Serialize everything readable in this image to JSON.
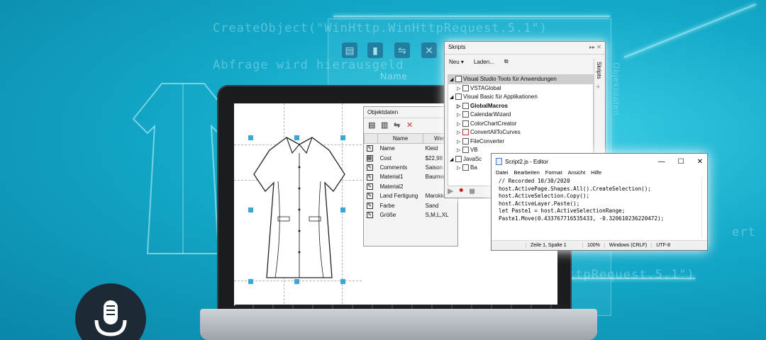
{
  "background": {
    "code_lines": [
      "CreateObject(\"WinHttp.WinHttpRequest.5.1\")",
      "Abfrage wird hierausgeld",
      "ttpRequest.5.1\")",
      "ert"
    ],
    "panel_label": "Name",
    "side_label": "Objektdaten"
  },
  "objektdaten": {
    "title": "Objektdaten",
    "headers": [
      "Name",
      "Wert"
    ],
    "rows": [
      {
        "name": "Name",
        "value": "Kleid"
      },
      {
        "name": "Cost",
        "value": "$22,98"
      },
      {
        "name": "Comments",
        "value": "Saison W5"
      },
      {
        "name": "Material1",
        "value": "Baumwoll"
      },
      {
        "name": "Material2",
        "value": ""
      },
      {
        "name": "Land Fertigung",
        "value": "Marokko"
      },
      {
        "name": "Farbe",
        "value": "Sand"
      },
      {
        "name": "Größe",
        "value": "S,M,L,XL"
      }
    ]
  },
  "skripts": {
    "title": "Skripts",
    "menu": {
      "new": "Neu",
      "load": "Laden..."
    },
    "side_tab": "Skripts",
    "tree": [
      {
        "label": "Visual Studio Tools für Anwendungen",
        "level": 0,
        "toggle": "◢",
        "selected": true
      },
      {
        "label": "VSTAGlobal",
        "level": 1,
        "toggle": "▷"
      },
      {
        "label": "Visual Basic für Applikationen",
        "level": 0,
        "toggle": "◢"
      },
      {
        "label": "GlobalMacros",
        "level": 1,
        "toggle": "▷",
        "bold": true
      },
      {
        "label": "CalendarWizard",
        "level": 1,
        "toggle": "▷"
      },
      {
        "label": "ColorChartCreator",
        "level": 1,
        "toggle": "▷"
      },
      {
        "label": "ConvertAllToCurves",
        "level": 1,
        "toggle": "▷"
      },
      {
        "label": "FileConverter",
        "level": 1,
        "toggle": "▷"
      },
      {
        "label": "VB",
        "level": 1,
        "toggle": "▷"
      },
      {
        "label": "JavaSc",
        "level": 0,
        "toggle": "◢"
      },
      {
        "label": "Ba",
        "level": 1,
        "toggle": "▷"
      }
    ]
  },
  "editor": {
    "title": "Script2.js - Editor",
    "menu": [
      "Datei",
      "Bearbeiten",
      "Format",
      "Ansicht",
      "Hilfe"
    ],
    "code": [
      "// Recorded 10/30/2020",
      "host.ActivePage.Shapes.All().CreateSelection();",
      "host.ActiveSelection.Copy();",
      "host.ActiveLayer.Paste();",
      "let Paste1 = host.ActiveSelectionRange;",
      "Paste1.Move(0.433767716535433, -0.320610236220472);"
    ],
    "status": {
      "position": "Zeile 1, Spalte 1",
      "zoom": "100%",
      "line_ending": "Windows (CRLF)",
      "encoding": "UTF-8"
    }
  },
  "colors": {
    "accent": "#14a9c9",
    "handle": "#39a7d9"
  }
}
